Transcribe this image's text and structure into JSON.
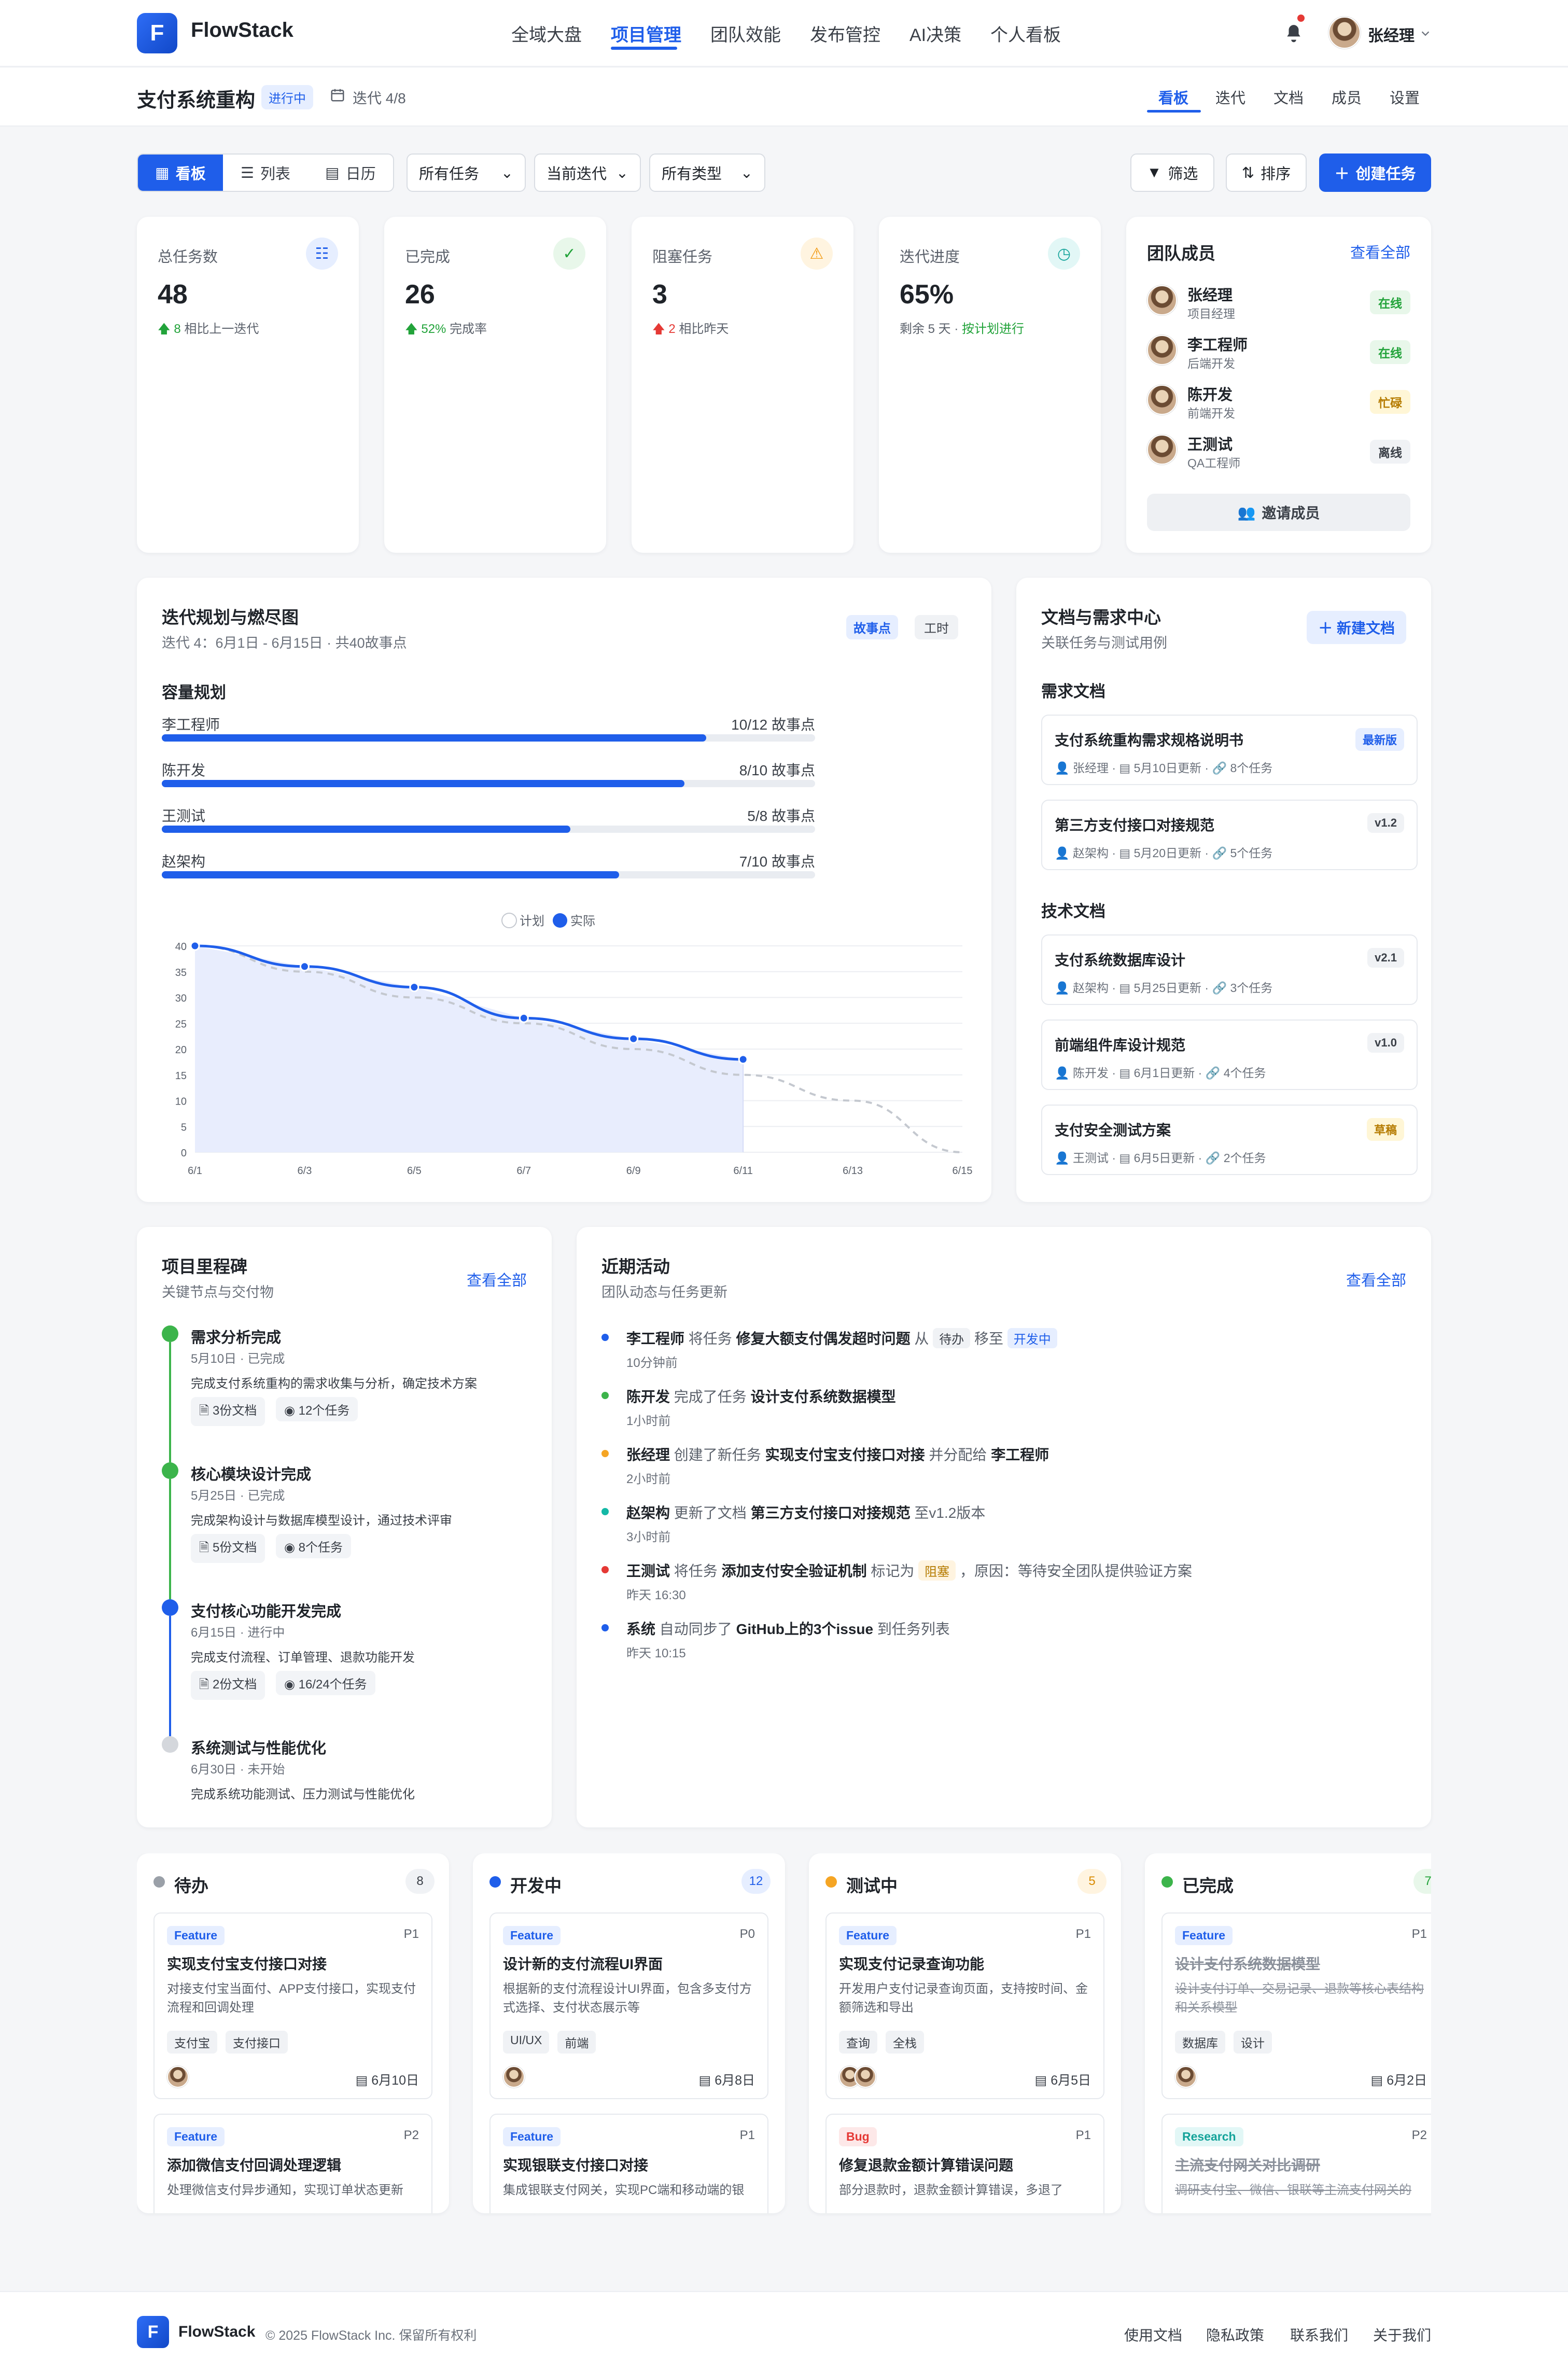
{
  "app": {
    "logo_letter": "F",
    "name": "FlowStack"
  },
  "nav": [
    "全域大盘",
    "项目管理",
    "团队效能",
    "发布管控",
    "AI决策",
    "个人看板"
  ],
  "user": {
    "name": "张经理"
  },
  "project": {
    "title": "支付系统重构",
    "status": "进行中",
    "iteration": "迭代 4/8"
  },
  "subtabs": [
    "看板",
    "迭代",
    "文档",
    "成员",
    "设置"
  ],
  "views": [
    "看板",
    "列表",
    "日历"
  ],
  "filters": [
    "所有任务",
    "当前迭代",
    "所有类型"
  ],
  "actions": {
    "filter": "筛选",
    "sort": "排序",
    "create": "创建任务"
  },
  "stats": [
    {
      "label": "总任务数",
      "value": "48",
      "delta": "8",
      "sub": "相比上一迭代"
    },
    {
      "label": "已完成",
      "value": "26",
      "delta": "52%",
      "sub": "完成率"
    },
    {
      "label": "阻塞任务",
      "value": "3",
      "delta": "2",
      "sub": "相比昨天"
    },
    {
      "label": "迭代进度",
      "value": "65%",
      "sub": "剩余 5 天 · ",
      "sub_ok": "按计划进行"
    }
  ],
  "members": {
    "title": "团队成员",
    "view_all": "查看全部",
    "invite": "邀请成员",
    "list": [
      {
        "name": "张经理",
        "role": "项目经理",
        "status": "在线"
      },
      {
        "name": "李工程师",
        "role": "后端开发",
        "status": "在线"
      },
      {
        "name": "陈开发",
        "role": "前端开发",
        "status": "忙碌"
      },
      {
        "name": "王测试",
        "role": "QA工程师",
        "status": "离线"
      }
    ]
  },
  "sprint": {
    "title": "迭代规划与燃尽图",
    "subtitle": "迭代 4：6月1日 - 6月15日 · 共40故事点",
    "toggle": [
      "故事点",
      "工时"
    ],
    "capacity_title": "容量规划",
    "capacity": [
      {
        "name": "李工程师",
        "value": "10/12 故事点",
        "ratio": 0.833
      },
      {
        "name": "陈开发",
        "value": "8/10 故事点",
        "ratio": 0.8
      },
      {
        "name": "王测试",
        "value": "5/8 故事点",
        "ratio": 0.625
      },
      {
        "name": "赵架构",
        "value": "7/10 故事点",
        "ratio": 0.7
      }
    ]
  },
  "chart_data": {
    "type": "line",
    "x": [
      "6/1",
      "6/3",
      "6/5",
      "6/7",
      "6/9",
      "6/11",
      "6/13",
      "6/15"
    ],
    "series": [
      {
        "name": "计划",
        "values": [
          40,
          35,
          30,
          25,
          20,
          15,
          10,
          0
        ],
        "style": "dashed",
        "color": "#c4c8cf"
      },
      {
        "name": "实际",
        "values": [
          40,
          36,
          32,
          26,
          22,
          18
        ],
        "style": "solid-area",
        "color": "#1f5eea"
      }
    ],
    "yticks": [
      0,
      5,
      10,
      15,
      20,
      25,
      30,
      35,
      40
    ],
    "ylim": [
      0,
      40
    ],
    "grid": true,
    "legend": "top-center"
  },
  "docs": {
    "title": "文档与需求中心",
    "subtitle": "关联任务与测试用例",
    "new": "新建文档",
    "req_title": "需求文档",
    "tech_title": "技术文档",
    "req": [
      {
        "title": "支付系统重构需求规格说明书",
        "author": "张经理",
        "date": "5月10日更新",
        "tasks": "8个任务",
        "tag": "最新版"
      },
      {
        "title": "第三方支付接口对接规范",
        "author": "赵架构",
        "date": "5月20日更新",
        "tasks": "5个任务",
        "tag": "v1.2"
      }
    ],
    "tech": [
      {
        "title": "支付系统数据库设计",
        "author": "赵架构",
        "date": "5月25日更新",
        "tasks": "3个任务",
        "tag": "v2.1"
      },
      {
        "title": "前端组件库设计规范",
        "author": "陈开发",
        "date": "6月1日更新",
        "tasks": "4个任务",
        "tag": "v1.0"
      },
      {
        "title": "支付安全测试方案",
        "author": "王测试",
        "date": "6月5日更新",
        "tasks": "2个任务",
        "tag": "草稿"
      }
    ]
  },
  "milestones": {
    "title": "项目里程碑",
    "subtitle": "关键节点与交付物",
    "view_all": "查看全部",
    "list": [
      {
        "title": "需求分析完成",
        "date": "5月10日 · 已完成",
        "desc": "完成支付系统重构的需求收集与分析，确定技术方案",
        "docs": "3份文档",
        "tasks": "12个任务"
      },
      {
        "title": "核心模块设计完成",
        "date": "5月25日 · 已完成",
        "desc": "完成架构设计与数据库模型设计，通过技术评审",
        "docs": "5份文档",
        "tasks": "8个任务"
      },
      {
        "title": "支付核心功能开发完成",
        "date": "6月15日 · 进行中",
        "desc": "完成支付流程、订单管理、退款功能开发",
        "docs": "2份文档",
        "tasks": "16/24个任务"
      },
      {
        "title": "系统测试与性能优化",
        "date": "6月30日 · 未开始",
        "desc": "完成系统功能测试、压力测试与性能优化"
      }
    ]
  },
  "activity": {
    "title": "近期活动",
    "subtitle": "团队动态与任务更新",
    "view_all": "查看全部",
    "list": [
      {
        "who": "李工程师",
        "a": "将任务",
        "obj": "修复大额支付偶发超时问题",
        "b": "从",
        "t1": "待办",
        "c": "移至",
        "t2": "开发中",
        "time": "10分钟前"
      },
      {
        "who": "陈开发",
        "a": "完成了任务",
        "obj": "设计支付系统数据模型",
        "time": "1小时前"
      },
      {
        "who": "张经理",
        "a": "创建了新任务",
        "obj": "实现支付宝支付接口对接",
        "b": "并分配给",
        "who2": "李工程师",
        "time": "2小时前"
      },
      {
        "who": "赵架构",
        "a": "更新了文档",
        "obj": "第三方支付接口对接规范",
        "b": "至v1.2版本",
        "time": "3小时前"
      },
      {
        "who": "王测试",
        "a": "将任务",
        "obj": "添加支付安全验证机制",
        "b": "标记为",
        "t1": "阻塞",
        "c": "，原因：等待安全团队提供验证方案",
        "time": "昨天 16:30"
      },
      {
        "who": "系统",
        "a": "自动同步了",
        "obj": "GitHub上的3个issue",
        "b": "到任务列表",
        "time": "昨天 10:15"
      }
    ]
  },
  "board": [
    {
      "title": "待办",
      "count": "8",
      "tasks": [
        {
          "type": "Feature",
          "pri": "P1",
          "title": "实现支付宝支付接口对接",
          "desc": "对接支付宝当面付、APP支付接口，实现支付流程和回调处理",
          "tags": [
            "支付宝",
            "支付接口"
          ],
          "date": "6月10日"
        },
        {
          "type": "Feature",
          "pri": "P2",
          "title": "添加微信支付回调处理逻辑",
          "desc": "处理微信支付异步通知，实现订单状态更新"
        }
      ]
    },
    {
      "title": "开发中",
      "count": "12",
      "tasks": [
        {
          "type": "Feature",
          "pri": "P0",
          "title": "设计新的支付流程UI界面",
          "desc": "根据新的支付流程设计UI界面，包含多支付方式选择、支付状态展示等",
          "tags": [
            "UI/UX",
            "前端"
          ],
          "date": "6月8日"
        },
        {
          "type": "Feature",
          "pri": "P1",
          "title": "实现银联支付接口对接",
          "desc": "集成银联支付网关，实现PC端和移动端的银"
        }
      ]
    },
    {
      "title": "测试中",
      "count": "5",
      "tasks": [
        {
          "type": "Feature",
          "pri": "P1",
          "title": "实现支付记录查询功能",
          "desc": "开发用户支付记录查询页面，支持按时间、金额筛选和导出",
          "tags": [
            "查询",
            "全栈"
          ],
          "date": "6月5日"
        },
        {
          "type": "Bug",
          "pri": "P1",
          "title": "修复退款金额计算错误问题",
          "desc": "部分退款时，退款金额计算错误，多退了"
        }
      ]
    },
    {
      "title": "已完成",
      "count": "7",
      "tasks": [
        {
          "type": "Feature",
          "pri": "P1",
          "title": "设计支付系统数据模型",
          "desc": "设计支付订单、交易记录、退款等核心表结构和关系模型",
          "tags": [
            "数据库",
            "设计"
          ],
          "date": "6月2日"
        },
        {
          "type": "Research",
          "pri": "P2",
          "title": "主流支付网关对比调研",
          "desc": "调研支付宝、微信、银联等主流支付网关的"
        }
      ]
    }
  ],
  "footer": {
    "copyright": "© 2025 FlowStack Inc. 保留所有权利",
    "links": [
      "使用文档",
      "隐私政策",
      "联系我们",
      "关于我们"
    ]
  }
}
